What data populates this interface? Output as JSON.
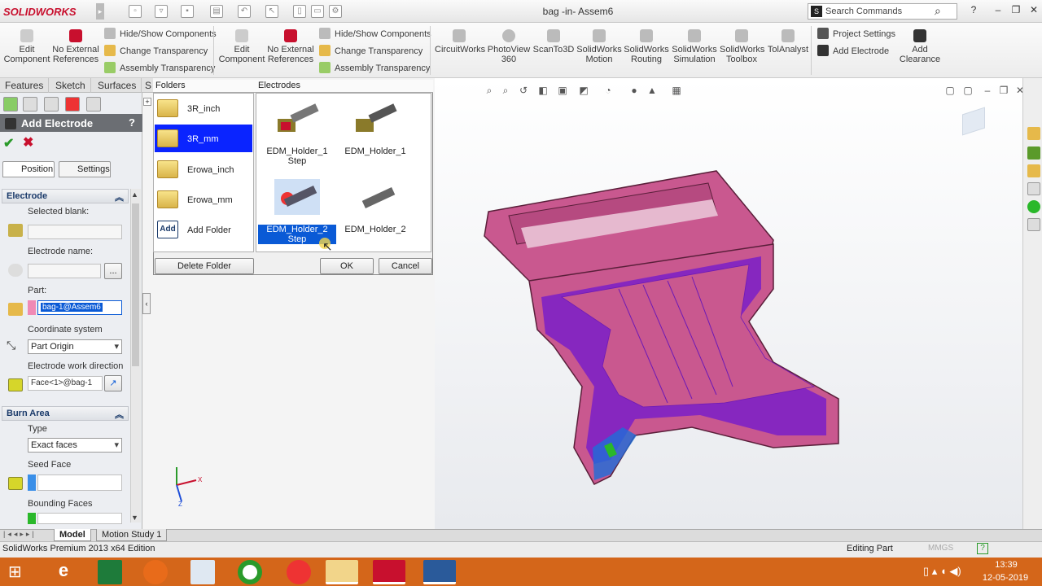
{
  "app": {
    "logo_text": "SOLIDWORKS",
    "document_title": "bag -in- Assem6",
    "search_placeholder": "Search Commands"
  },
  "ribbon": {
    "group1": {
      "edit_component": "Edit Component",
      "no_external_refs": "No External References"
    },
    "group1_small": [
      "Hide/Show Components",
      "Change Transparency",
      "Assembly Transparency"
    ],
    "group2": {
      "edit_component": "Edit Component",
      "no_external_refs": "No External References"
    },
    "group2_small": [
      "Hide/Show Components",
      "Change Transparency",
      "Assembly Transparency"
    ],
    "addins": [
      "CircuitWorks",
      "PhotoView 360",
      "ScanTo3D",
      "SolidWorks Motion",
      "SolidWorks Routing",
      "SolidWorks Simulation",
      "SolidWorks Toolbox",
      "TolAnalyst"
    ],
    "project_settings": "Project Settings",
    "add_electrode": "Add Electrode",
    "add_clearance": "Add Clearance"
  },
  "cm_tabs": [
    "Features",
    "Sketch",
    "Surfaces",
    "S"
  ],
  "property_manager": {
    "title": "Add Electrode",
    "help": "?",
    "tabs": {
      "position": "Position",
      "settings": "Settings"
    },
    "electrode_group": "Electrode",
    "selected_blank_label": "Selected blank:",
    "electrode_name_label": "Electrode name:",
    "browse_button": "...",
    "part_label": "Part:",
    "part_value": "bag-1@Assem6",
    "coord_system_label": "Coordinate system",
    "coord_system_value": "Part Origin",
    "work_direction_label": "Electrode work direction",
    "work_direction_value": "Face<1>@bag-1",
    "burn_area_group": "Burn Area",
    "type_label": "Type",
    "type_value": "Exact faces",
    "seed_face_label": "Seed Face",
    "bounding_faces_label": "Bounding Faces"
  },
  "dialog": {
    "folders_header": "Folders",
    "electrodes_header": "Electrodes",
    "folders": [
      "3R_inch",
      "3R_mm",
      "Erowa_inch",
      "Erowa_mm",
      "Add Folder"
    ],
    "add_icon_text": "Add",
    "selected_folder": "3R_mm",
    "electrodes": [
      "EDM_Holder_1 Step",
      "EDM_Holder_1",
      "EDM_Holder_2 Step",
      "EDM_Holder_2"
    ],
    "selected_electrode": "EDM_Holder_2 Step",
    "delete_folder": "Delete Folder",
    "ok": "OK",
    "cancel": "Cancel"
  },
  "bottom_tabs": [
    "Model",
    "Motion Study 1"
  ],
  "status": {
    "edition": "SolidWorks Premium 2013 x64 Edition",
    "mode": "Editing Part",
    "units": "MMGS",
    "help": "?"
  },
  "taskbar": {
    "time": "13:39",
    "date": "12-05-2019"
  },
  "colors": {
    "part": "#c9588f",
    "cavity": "#7a1ec8",
    "selection": "#0a24ff",
    "taskbar": "#d4661a"
  }
}
